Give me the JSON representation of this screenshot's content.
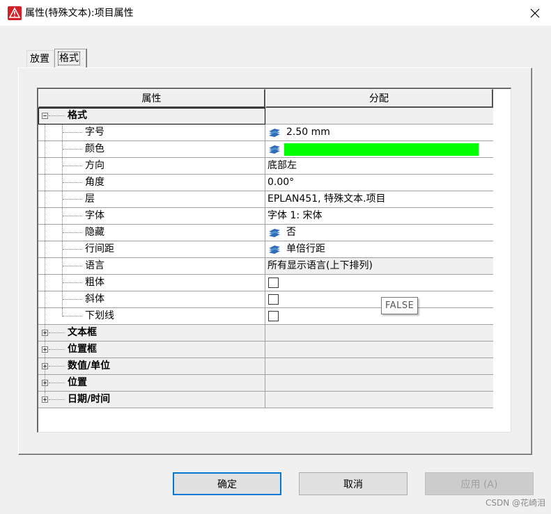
{
  "window": {
    "title": "属性(特殊文本):项目属性",
    "close_glyph": "✕"
  },
  "tabs": [
    {
      "label": "放置",
      "active": false
    },
    {
      "label": "格式",
      "active": true
    }
  ],
  "grid": {
    "headers": [
      "属性",
      "分配"
    ],
    "groups": [
      {
        "label": "格式",
        "expanded": true,
        "rows": [
          {
            "name": "字号",
            "value": "2.50 mm",
            "icon": "layer-stack-icon"
          },
          {
            "name": "颜色",
            "value": "",
            "swatch": "#00ff00",
            "icon": "layer-stack-icon"
          },
          {
            "name": "方向",
            "value": "底部左"
          },
          {
            "name": "角度",
            "value": "0.00°"
          },
          {
            "name": "层",
            "value": "EPLAN451, 特殊文本.项目"
          },
          {
            "name": "字体",
            "value": "字体 1: 宋体"
          },
          {
            "name": "隐藏",
            "value": "否",
            "icon": "layer-stack-icon"
          },
          {
            "name": "行间距",
            "value": "单倍行距",
            "icon": "layer-stack-icon"
          },
          {
            "name": "语言",
            "value": "所有显示语言(上下排列)"
          },
          {
            "name": "粗体",
            "checkbox": false
          },
          {
            "name": "斜体",
            "checkbox": false
          },
          {
            "name": "下划线",
            "checkbox": false
          }
        ]
      },
      {
        "label": "文本框",
        "expanded": false
      },
      {
        "label": "位置框",
        "expanded": false
      },
      {
        "label": "数值/单位",
        "expanded": false
      },
      {
        "label": "位置",
        "expanded": false
      },
      {
        "label": "日期/时间",
        "expanded": false
      }
    ]
  },
  "tooltip": "FALSE",
  "buttons": {
    "ok": "确定",
    "cancel": "取消",
    "apply": "应用 (A)"
  },
  "watermark": "CSDN @花崎泪",
  "colors": {
    "accent": "#0078d7",
    "app_icon": "#d32027",
    "color_swatch": "#00ff00"
  }
}
